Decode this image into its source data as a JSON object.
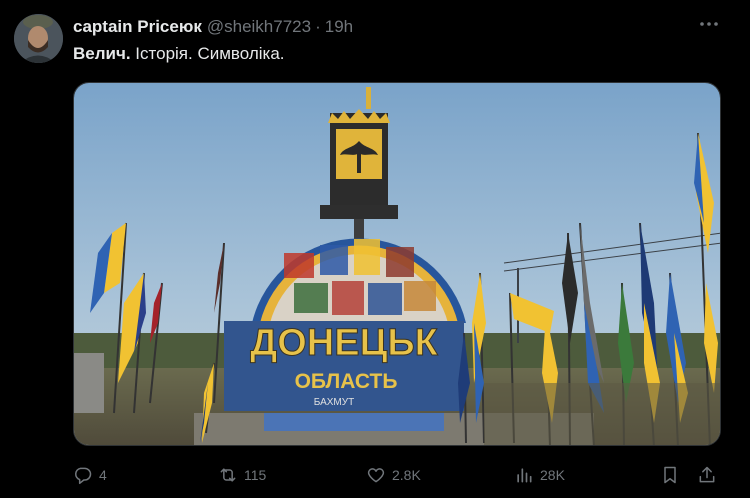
{
  "post": {
    "display_name": "captain Prісеюк",
    "handle": "@sheikh7723",
    "separator": "·",
    "time": "19h",
    "text_bold": "Велич.",
    "text_rest": " Історія. Символіка."
  },
  "photo": {
    "sign_line1": "ДОНЕЦЬК",
    "sign_line2": "ОБЛАСТЬ",
    "sign_line3": "БАХМУТ",
    "emblem_text": "ДОНЕЦЬКА ОБЛАСТЬ"
  },
  "actions": {
    "replies": "4",
    "reposts": "115",
    "likes": "2.8K",
    "views": "28K"
  },
  "icons": [
    "more-icon",
    "reply-icon",
    "repost-icon",
    "like-icon",
    "views-icon",
    "bookmark-icon",
    "share-icon"
  ],
  "colors": {
    "background": "#000000",
    "text": "#e7e9ea",
    "muted": "#71767b"
  }
}
